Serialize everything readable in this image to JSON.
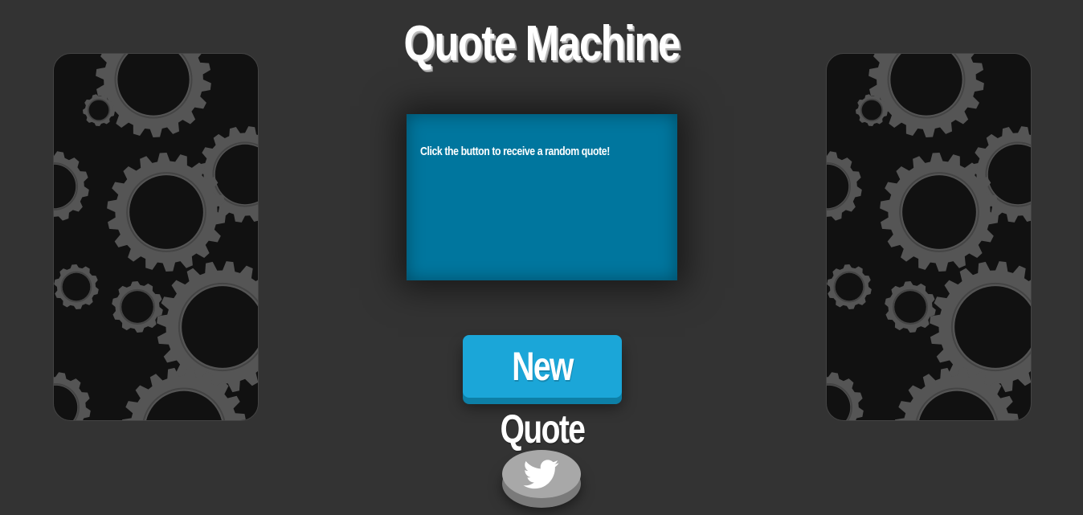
{
  "header": {
    "title": "Quote Machine"
  },
  "quote": {
    "text": "Click the button to receive a random quote!"
  },
  "actions": {
    "new_quote_label": "New Quote",
    "tweet_icon": "twitter-bird-icon"
  },
  "decoration": {
    "left_panel_icon": "gears-icon",
    "right_panel_icon": "gears-icon"
  },
  "colors": {
    "background": "#333333",
    "quote_box": "#00769e",
    "button": "#1ba6d8",
    "tweet_button": "#a8a8a8",
    "gear": "#555555"
  }
}
